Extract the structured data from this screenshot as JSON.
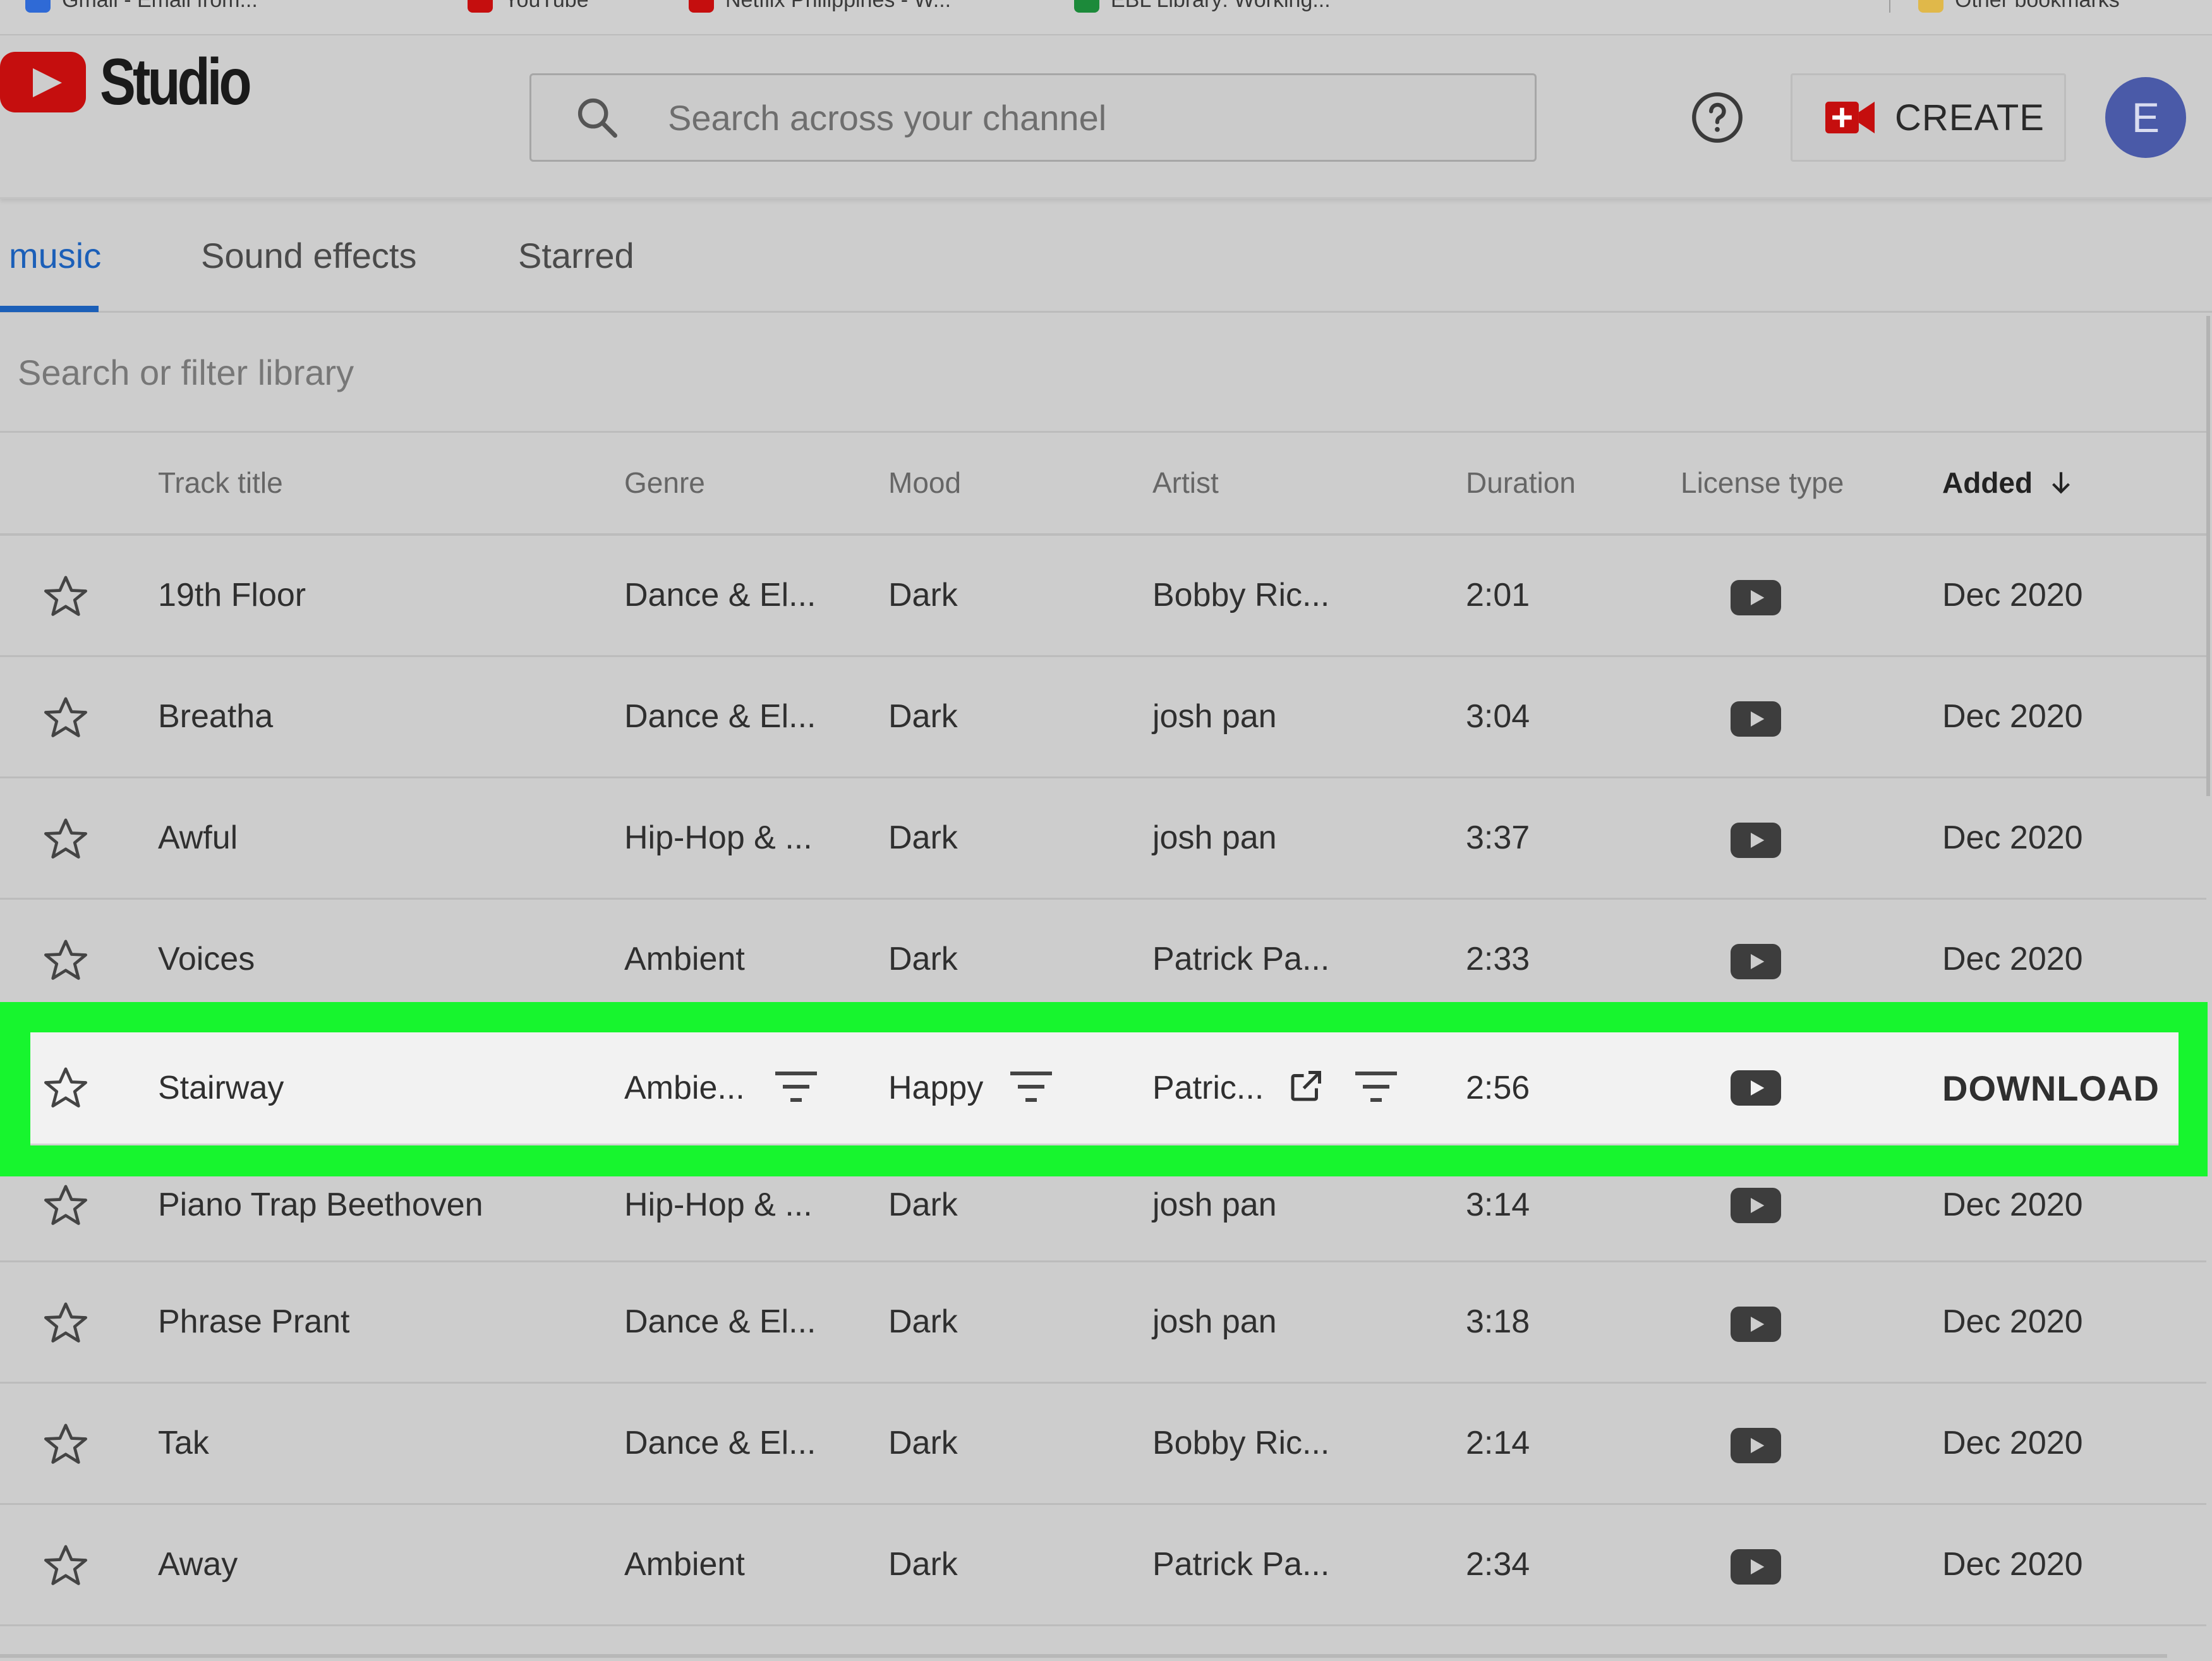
{
  "bookmarks": [
    {
      "label": "Gmail - Email from...",
      "color": "#2f6ad6"
    },
    {
      "label": "YouTube",
      "color": "#c50e0e"
    },
    {
      "label": "Netflix Philippines - W...",
      "color": "#c50e0e"
    },
    {
      "label": "EBL Library: Working...",
      "color": "#1c8a3a"
    },
    {
      "label": "Other bookmarks",
      "color": "#e0b84a"
    }
  ],
  "header": {
    "logo_text": "Studio",
    "search_placeholder": "Search across your channel",
    "create_label": "CREATE",
    "avatar_letter": "E"
  },
  "tabs": [
    {
      "label": "music",
      "active": true
    },
    {
      "label": "Sound effects",
      "active": false
    },
    {
      "label": "Starred",
      "active": false
    }
  ],
  "filter": {
    "placeholder": "Search or filter library"
  },
  "columns": {
    "track_title": "Track title",
    "genre": "Genre",
    "mood": "Mood",
    "artist": "Artist",
    "duration": "Duration",
    "license_type": "License type",
    "added": "Added"
  },
  "rows": [
    {
      "title": "19th Floor",
      "genre": "Dance & El...",
      "mood": "Dark",
      "artist": "Bobby Ric...",
      "duration": "2:01",
      "added": "Dec 2020"
    },
    {
      "title": "Breatha",
      "genre": "Dance & El...",
      "mood": "Dark",
      "artist": "josh pan",
      "duration": "3:04",
      "added": "Dec 2020"
    },
    {
      "title": "Awful",
      "genre": "Hip-Hop & ...",
      "mood": "Dark",
      "artist": "josh pan",
      "duration": "3:37",
      "added": "Dec 2020"
    },
    {
      "title": "Voices",
      "genre": "Ambient",
      "mood": "Dark",
      "artist": "Patrick Pa...",
      "duration": "2:33",
      "added": "Dec 2020"
    },
    {
      "title": "Stairway",
      "genre": "Ambie...",
      "mood": "Happy",
      "artist": "Patric...",
      "duration": "2:56",
      "action": "DOWNLOAD"
    },
    {
      "title": "Piano Trap Beethoven",
      "genre": "Hip-Hop & ...",
      "mood": "Dark",
      "artist": "josh pan",
      "duration": "3:14",
      "added": "Dec 2020"
    },
    {
      "title": "Phrase Prant",
      "genre": "Dance & El...",
      "mood": "Dark",
      "artist": "josh pan",
      "duration": "3:18",
      "added": "Dec 2020"
    },
    {
      "title": "Tak",
      "genre": "Dance & El...",
      "mood": "Dark",
      "artist": "Bobby Ric...",
      "duration": "2:14",
      "added": "Dec 2020"
    },
    {
      "title": "Away",
      "genre": "Ambient",
      "mood": "Dark",
      "artist": "Patrick Pa...",
      "duration": "2:34",
      "added": "Dec 2020"
    }
  ],
  "colors": {
    "accent_blue": "#1b5fb8",
    "download_blue": "#1a68d6",
    "highlight_green": "#17f52e",
    "brand_red": "#c50e0e"
  }
}
